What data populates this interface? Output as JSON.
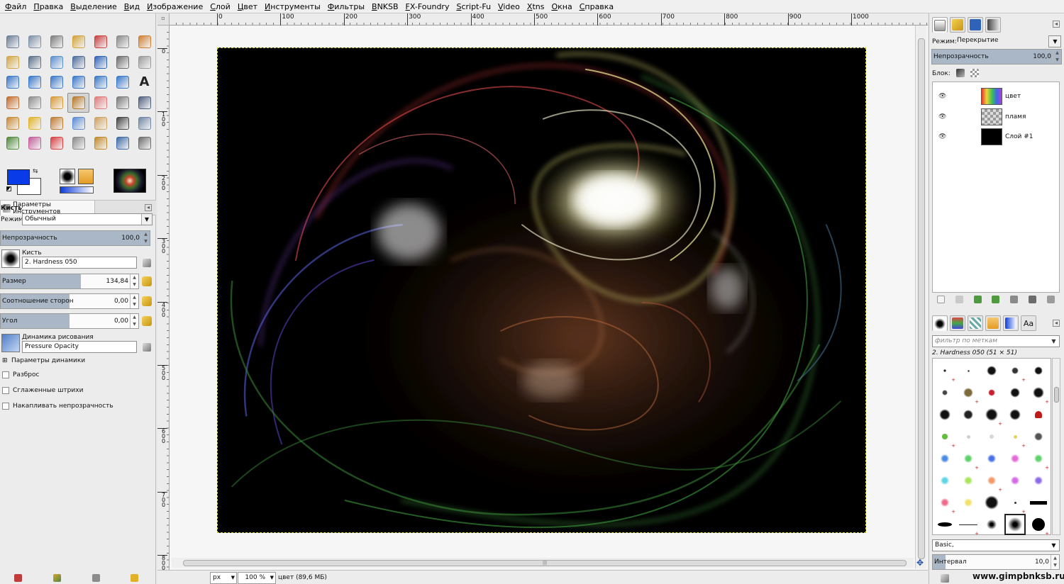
{
  "menu": [
    "Файл",
    "Правка",
    "Выделение",
    "Вид",
    "Изображение",
    "Слой",
    "Цвет",
    "Инструменты",
    "Фильтры",
    "BNKSB",
    "FX-Foundry",
    "Script-Fu",
    "Video",
    "Xtns",
    "Окна",
    "Справка"
  ],
  "tool_icons": [
    {
      "name": "rect-select-icon",
      "color": "#6b7d96"
    },
    {
      "name": "ellipse-select-icon",
      "color": "#8090a8"
    },
    {
      "name": "lasso-icon",
      "color": "#7d7d7d"
    },
    {
      "name": "fuzzy-select-icon",
      "color": "#d1a33b"
    },
    {
      "name": "color-select-icon",
      "color": "#c94040"
    },
    {
      "name": "scissors-icon",
      "color": "#8a8a8a"
    },
    {
      "name": "foreground-select-icon",
      "color": "#d07f32"
    },
    {
      "name": "paths-icon",
      "color": "#d3a645"
    },
    {
      "name": "color-picker-icon",
      "color": "#5a6f88"
    },
    {
      "name": "zoom-icon",
      "color": "#5c8fd0"
    },
    {
      "name": "measure-icon",
      "color": "#4d6c9a"
    },
    {
      "name": "move-icon",
      "color": "#2f63b8"
    },
    {
      "name": "align-icon",
      "color": "#6c6c6c"
    },
    {
      "name": "crop-icon",
      "color": "#9a9a9a"
    },
    {
      "name": "rotate-icon",
      "color": "#3b78c9"
    },
    {
      "name": "scale-icon",
      "color": "#3b78c9"
    },
    {
      "name": "shear-icon",
      "color": "#3b78c9"
    },
    {
      "name": "perspective-icon",
      "color": "#3b78c9"
    },
    {
      "name": "flip-icon",
      "color": "#3b78c9"
    },
    {
      "name": "cage-icon",
      "color": "#3b78c9"
    },
    {
      "name": "text-icon",
      "color": "#222222"
    },
    {
      "name": "bucket-fill-icon",
      "color": "#c56b2a"
    },
    {
      "name": "blend-icon",
      "color": "#8c8c8c"
    },
    {
      "name": "pencil-icon",
      "color": "#d89a36"
    },
    {
      "name": "paintbrush-icon",
      "color": "#b7792c"
    },
    {
      "name": "eraser-icon",
      "color": "#e07a7a"
    },
    {
      "name": "airbrush-icon",
      "color": "#7a7a7a"
    },
    {
      "name": "ink-icon",
      "color": "#4e5f7d"
    },
    {
      "name": "clone-icon",
      "color": "#c98a35"
    },
    {
      "name": "heal-icon",
      "color": "#e0b22d"
    },
    {
      "name": "perspective-clone-icon",
      "color": "#c07a30"
    },
    {
      "name": "blur-icon",
      "color": "#5a8bd4"
    },
    {
      "name": "smudge-icon",
      "color": "#d0a060"
    },
    {
      "name": "dodge-burn-icon",
      "color": "#444444"
    },
    {
      "name": "gradient-map-icon",
      "color": "#6f86a5"
    },
    {
      "name": "levels-icon",
      "color": "#4f8a3b"
    },
    {
      "name": "color-balance-icon",
      "color": "#c25f9a"
    },
    {
      "name": "hue-saturation-icon",
      "color": "#d94141"
    },
    {
      "name": "threshold-icon",
      "color": "#8a8a8a"
    },
    {
      "name": "brightness-contrast-icon",
      "color": "#c28a2a"
    },
    {
      "name": "curves-icon",
      "color": "#3f6aa8"
    },
    {
      "name": "plugin-icon",
      "color": "#6d6d6d"
    }
  ],
  "tool_options": {
    "tab_title": "Параметры инструментов",
    "tool_name": "Кисть",
    "mode_label": "Режим:",
    "mode_value": "Обычный",
    "opacity_label": "Непрозрачность",
    "opacity_value": "100,0",
    "opacity_fraction": 1.0,
    "brush_label": "Кисть",
    "brush_value": "2. Hardness 050",
    "size_label": "Размер",
    "size_value": "134,84",
    "size_fraction": 0.58,
    "aspect_label": "Соотношение сторон",
    "aspect_value": "0,00",
    "aspect_fraction": 0.5,
    "angle_label": "Угол",
    "angle_value": "0,00",
    "angle_fraction": 0.5,
    "dynamics_label": "Динамика рисования",
    "dynamics_value": "Pressure Opacity",
    "dynamics_options_label": "Параметры динамики",
    "scatter_label": "Разброс",
    "smooth_label": "Сглаженные штрихи",
    "accumulate_label": "Накапливать непрозрачность"
  },
  "colors": {
    "foreground": "#0a3be8",
    "background": "#ffffff"
  },
  "ruler": {
    "h_ticks": [
      "0",
      "100",
      "200",
      "300",
      "400",
      "500",
      "600",
      "700",
      "800",
      "900",
      "1000"
    ],
    "v_ticks": [
      "0",
      "100",
      "200",
      "300",
      "400",
      "500",
      "600",
      "700",
      "800"
    ]
  },
  "status": {
    "unit": "px",
    "zoom": "100 %",
    "info": "цвет (89,6 МБ)"
  },
  "layers": {
    "mode_label": "Режим:",
    "mode_value": "Перекрытие",
    "opacity_label": "Непрозрачность",
    "opacity_value": "100,0",
    "opacity_fraction": 1.0,
    "lock_label": "Блок:",
    "items": [
      {
        "name": "цвет"
      },
      {
        "name": "пламя"
      },
      {
        "name": "Слой #1"
      }
    ]
  },
  "brushes": {
    "filter_placeholder": "фильтр по меткам",
    "selected_label": "2. Hardness 050 (51 × 51)",
    "tag_value": "Basic,",
    "spacing_label": "Интервал",
    "spacing_value": "10,0",
    "spacing_fraction": 0.1
  },
  "watermark": "www.gimpbnksb.ru"
}
